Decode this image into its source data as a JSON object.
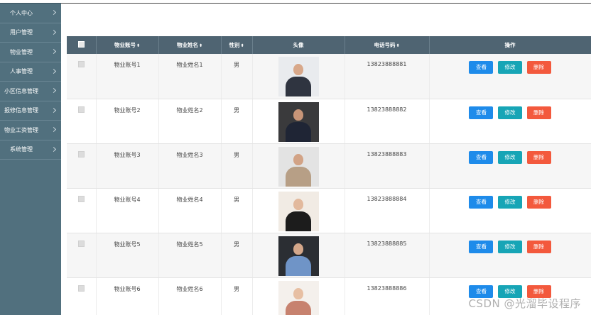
{
  "sidebar": {
    "items": [
      {
        "label": "个人中心"
      },
      {
        "label": "用户管理"
      },
      {
        "label": "物业管理"
      },
      {
        "label": "人事管理"
      },
      {
        "label": "小区信息管理"
      },
      {
        "label": "报修信息管理"
      },
      {
        "label": "物业工资管理"
      },
      {
        "label": "系统管理"
      }
    ]
  },
  "table": {
    "headers": {
      "account": "物业账号",
      "name": "物业姓名",
      "gender": "性别",
      "avatar": "头像",
      "phone": "电话号码",
      "actions": "操作"
    },
    "sort_symbol": "⬍",
    "rows": [
      {
        "account": "物业账号1",
        "name": "物业姓名1",
        "gender": "男",
        "phone": "13823888881",
        "avatar_icon": "person-photo-icon",
        "bg": "#e9ebee",
        "skin": "#d8a88a",
        "cloth": "#2f3440"
      },
      {
        "account": "物业账号2",
        "name": "物业姓名2",
        "gender": "男",
        "phone": "13823888882",
        "avatar_icon": "person-photo-icon",
        "bg": "#3a3a3c",
        "skin": "#c89578",
        "cloth": "#1f2535"
      },
      {
        "account": "物业账号3",
        "name": "物业姓名3",
        "gender": "男",
        "phone": "13823888883",
        "avatar_icon": "person-photo-icon",
        "bg": "#e3e3e3",
        "skin": "#d2a386",
        "cloth": "#b79f86"
      },
      {
        "account": "物业账号4",
        "name": "物业姓名4",
        "gender": "男",
        "phone": "13823888884",
        "avatar_icon": "person-photo-icon",
        "bg": "#f1ebe4",
        "skin": "#e2b99d",
        "cloth": "#1c1c1c"
      },
      {
        "account": "物业账号5",
        "name": "物业姓名5",
        "gender": "男",
        "phone": "13823888885",
        "avatar_icon": "person-photo-icon",
        "bg": "#2b2e33",
        "skin": "#d4a78a",
        "cloth": "#6f94c7"
      },
      {
        "account": "物业账号6",
        "name": "物业姓名6",
        "gender": "男",
        "phone": "13823888886",
        "avatar_icon": "person-photo-icon",
        "bg": "#f4f0ec",
        "skin": "#e7bfa3",
        "cloth": "#c7826f"
      }
    ],
    "buttons": {
      "view": "查看",
      "edit": "修改",
      "delete": "删除"
    }
  },
  "watermark": "CSDN @光溜毕设程序",
  "colors": {
    "sidebar_bg": "#51707e",
    "header_bg": "#4f6472",
    "btn_view": "#1e8bea",
    "btn_edit": "#17a5b6",
    "btn_delete": "#f3593d"
  }
}
